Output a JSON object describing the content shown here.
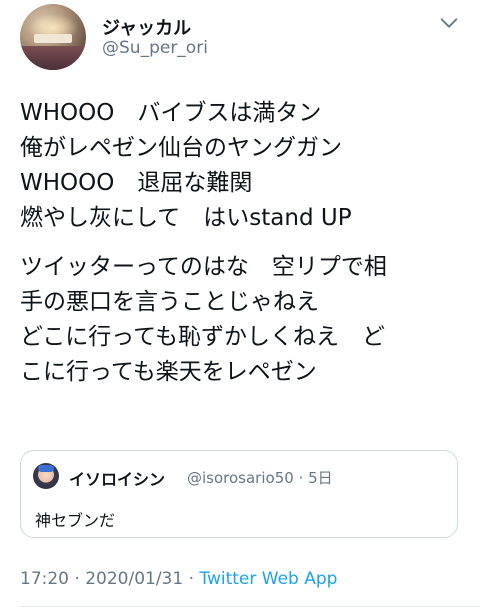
{
  "author": {
    "display_name": "ジャッカル",
    "username": "@Su_per_ori"
  },
  "tweet": {
    "lines": [
      "WHOOO　バイブスは満タン",
      "俺がレペゼン仙台のヤングガン",
      "WHOOO　退屈な難関",
      "燃やし灰にして　はいstand UP"
    ],
    "lines2": [
      "ツイッターってのはな　空リプで相",
      "手の悪口を言うことじゃねえ",
      "どこに行っても恥ずかしくねえ　ど",
      "こに行っても楽天をレペゼン"
    ]
  },
  "quote": {
    "name": "イソロイシン",
    "handle": "@isorosario50 · 5日",
    "text": "神セブンだ"
  },
  "meta": {
    "timestamp": "17:20 · 2020/01/31 · ",
    "source": "Twitter Web App"
  },
  "icons": {
    "menu": "chevron-down-icon"
  },
  "colors": {
    "primary_text": "#0f1419",
    "secondary_text": "#657786",
    "link": "#1da1f2",
    "border": "#cfd9de"
  }
}
